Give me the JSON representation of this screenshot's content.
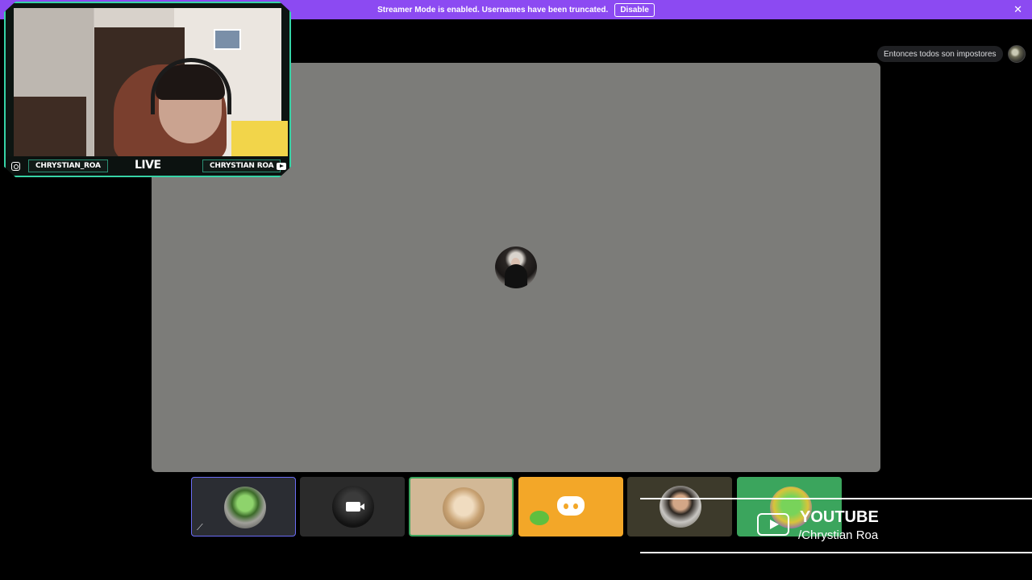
{
  "banner": {
    "text": "Streamer Mode is enabled. Usernames have been truncated.",
    "disable_label": "Disable",
    "close_glyph": "✕",
    "background": "#8c4af2"
  },
  "channel": {
    "name": "Entonces todos son impostores"
  },
  "webcam": {
    "left_handle": "CHRYSTIAN_ROA",
    "live_label": "LIVE",
    "right_handle": "CHRYSTIAN ROA",
    "frame_color": "#36d3a6"
  },
  "tiles": [
    {
      "id": "participant-1",
      "state": "selected",
      "icon": "mute-icon"
    },
    {
      "id": "participant-2",
      "state": "camera-off",
      "icon": "camera-icon"
    },
    {
      "id": "participant-3",
      "state": "speaking"
    },
    {
      "id": "participant-4",
      "state": "default-avatar",
      "icon": "discord-icon"
    },
    {
      "id": "participant-5",
      "state": "idle"
    },
    {
      "id": "participant-6",
      "state": "speaking"
    }
  ],
  "overlay": {
    "youtube_title": "YOUTUBE",
    "youtube_handle": "/Chrystian Roa"
  },
  "colors": {
    "stage_bg": "#000000",
    "main_video_bg": "#7c7c79",
    "speaking_green": "#3ba55d",
    "selected_blue": "#6a6cf6",
    "tile_orange": "#f3a728"
  }
}
